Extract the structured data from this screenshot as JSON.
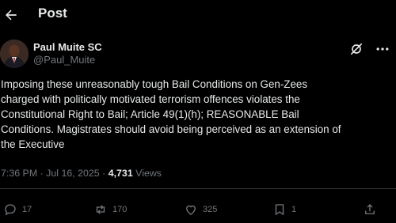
{
  "header": {
    "title": "Post"
  },
  "author": {
    "name": "Paul Muite SC",
    "handle": "@Paul_Muite"
  },
  "post": {
    "text": "Imposing these unreasonably tough Bail Conditions on Gen-Zees\ncharged with politically motivated terrorism offences violates the\nConstitutional Right to Bail; Article 49(1)(h); REASONABLE Bail\nConditions. Magistrates should avoid being perceived as an extension of\nthe Executive",
    "time": "7:36 PM",
    "separator": " · ",
    "date": "Jul 16, 2025",
    "views_count": "4,731",
    "views_label": " Views"
  },
  "actions": {
    "replies": "17",
    "reposts": "170",
    "likes": "325",
    "bookmarks": "1"
  }
}
